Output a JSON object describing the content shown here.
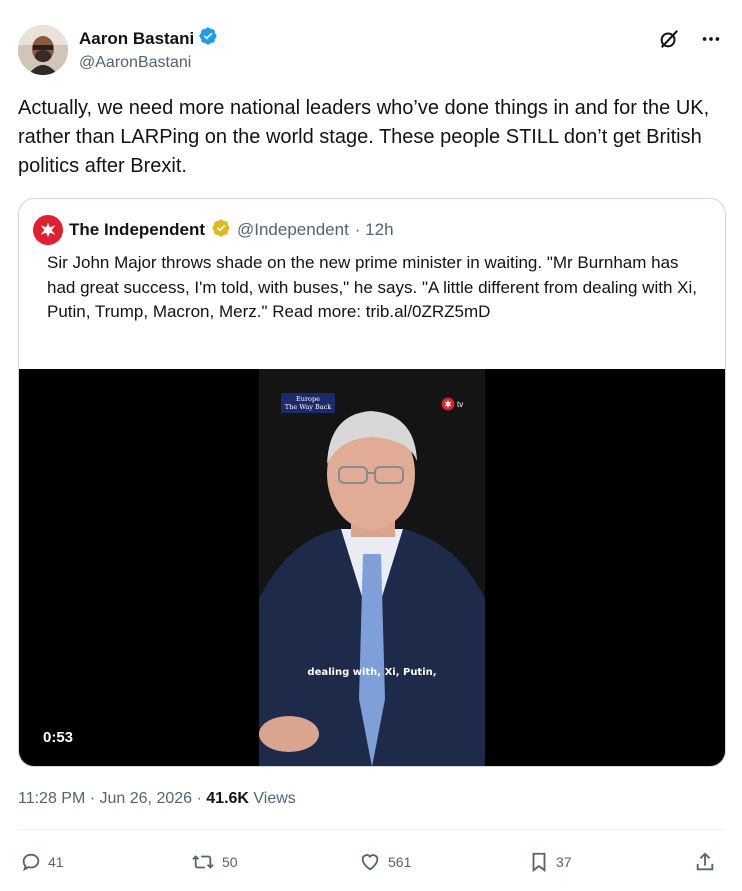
{
  "author": {
    "name": "Aaron Bastani",
    "handle": "@AaronBastani",
    "verified": true
  },
  "tweet": {
    "text": "Actually, we need more national leaders who’ve done things in and for the UK, rather than LARPing on the world stage.  These people STILL don’t get British politics after Brexit."
  },
  "quote": {
    "name": "The Independent",
    "handle": "@Independent",
    "time": "· 12h",
    "text": "Sir John Major throws shade on the new prime minister in waiting. \"Mr Burnham has had great success, I'm told, with buses,\" he says. \"A little different from dealing with Xi, Putin, Trump, Macron, Merz.\" Read more: trib.al/0ZRZ5mD",
    "video": {
      "duration": "0:53",
      "caption": "dealing with, Xi, Putin,",
      "badge_line1": "Europe",
      "badge_line2": "The Way Back",
      "tv_label": "tv"
    }
  },
  "meta": {
    "time": "11:28 PM · Jun 26, 2026 · ",
    "views_count": "41.6K",
    "views_label": " Views"
  },
  "actions": {
    "replies": "41",
    "reposts": "50",
    "likes": "561",
    "bookmarks": "37"
  },
  "colors": {
    "accent": "#1d9bf0",
    "gold": "#e2b719",
    "independent_red": "#e0202e",
    "secondary_text": "#536471"
  }
}
